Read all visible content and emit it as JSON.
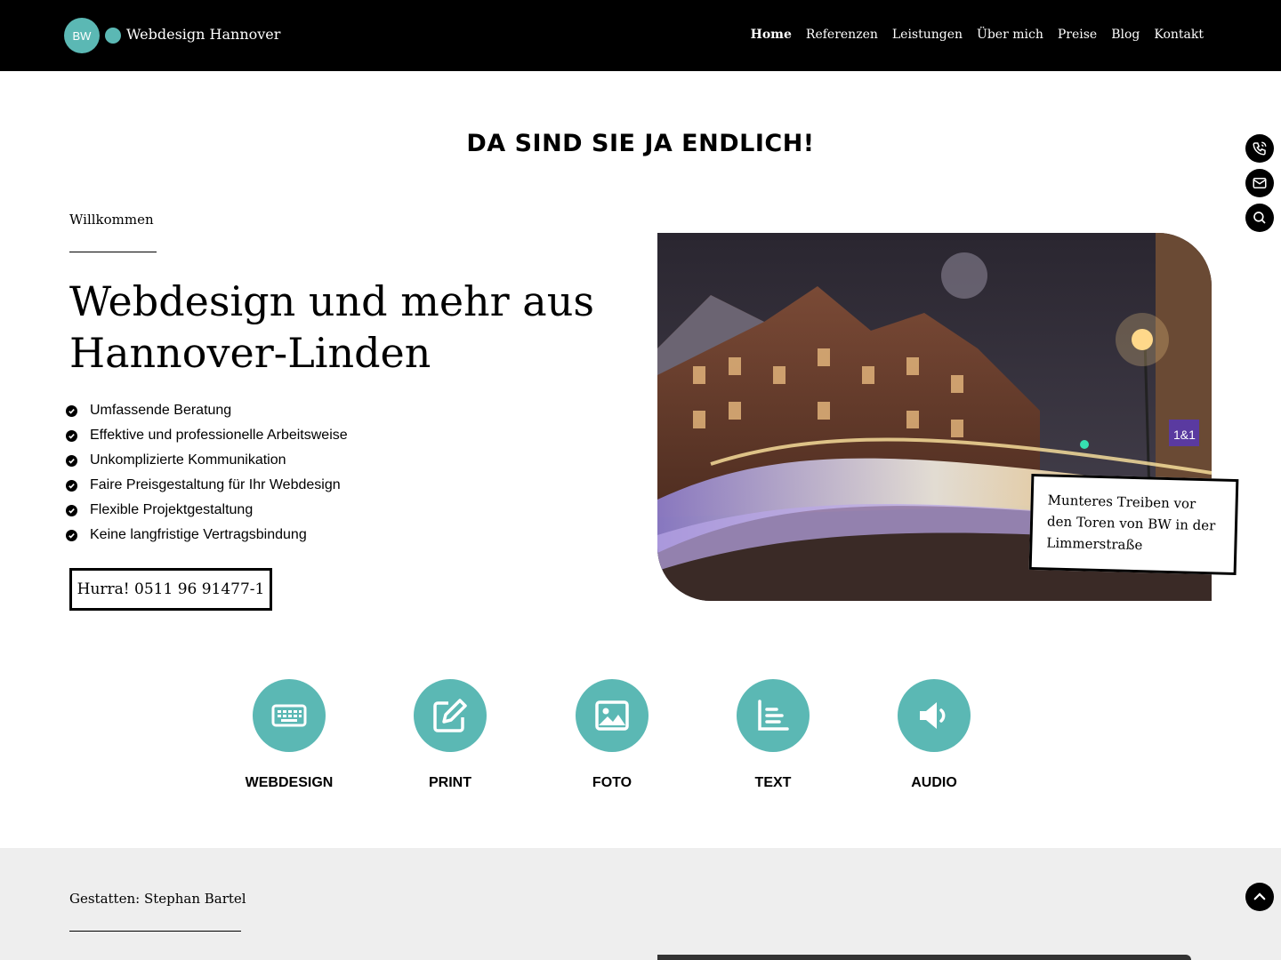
{
  "header": {
    "logo_initials": "BW",
    "logo_text": "Webdesign Hannover",
    "nav": [
      {
        "label": "Home",
        "active": true
      },
      {
        "label": "Referenzen"
      },
      {
        "label": "Leistungen"
      },
      {
        "label": "Über mich"
      },
      {
        "label": "Preise"
      },
      {
        "label": "Blog"
      },
      {
        "label": "Kontakt"
      }
    ]
  },
  "side_buttons": [
    "phone-icon",
    "mail-icon",
    "search-icon"
  ],
  "intro": {
    "heading": "DA SIND SIE JA ENDLICH!",
    "kicker": "Willkommen",
    "title_line1": "Webdesign und mehr aus",
    "title_line2": "Hannover-Linden",
    "bullets": [
      "Umfassende Beratung",
      "Effektive und professionelle Arbeitsweise",
      "Unkomplizierte Kommunikation",
      "Faire Preisgestaltung für Ihr Webdesign",
      "Flexible Projektgestaltung",
      "Keine langfristige Vertragsbindung"
    ],
    "cta_label": "Hurra! 0511 96 91477-1",
    "photo_caption": "Munteres Treiben vor den Toren von BW in der Limmerstraße"
  },
  "services": [
    {
      "label": "WEBDESIGN",
      "icon": "keyboard-icon"
    },
    {
      "label": "PRINT",
      "icon": "edit-icon"
    },
    {
      "label": "FOTO",
      "icon": "image-icon"
    },
    {
      "label": "TEXT",
      "icon": "chart-icon"
    },
    {
      "label": "AUDIO",
      "icon": "speaker-icon"
    }
  ],
  "about": {
    "kicker": "Gestatten: Stephan Bartel"
  },
  "colors": {
    "accent": "#5bb8b4",
    "header_bg": "#000000",
    "section_gray": "#eeeeee"
  }
}
